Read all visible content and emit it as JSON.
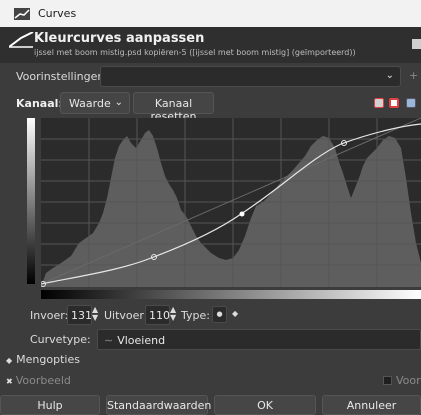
{
  "window": {
    "title": "Curves"
  },
  "header": {
    "title": "Kleurcurves aanpassen",
    "subtitle": "ijssel met boom mistig.psd kopiëren-5 ([ijssel met boom mistig] (geïmporteerd))"
  },
  "presets": {
    "label": "Voorinstellingen:",
    "value": "",
    "add": "+"
  },
  "channel": {
    "label": "Kanaal:",
    "value": "Waarde",
    "reset_label": "Kanaal resetten"
  },
  "curve": {
    "points": [
      [
        0,
        0
      ],
      [
        70,
        33
      ],
      [
        131,
        110
      ],
      [
        196,
        214
      ]
    ],
    "range": [
      0,
      255
    ]
  },
  "io": {
    "input_label": "Invoer:",
    "input_value": "131",
    "output_label": "Uitvoer:",
    "output_value": "110",
    "type_label": "Type:"
  },
  "curvetype": {
    "label": "Curvetype:",
    "value": "Vloeiend"
  },
  "options": {
    "mengopties": "Mengopties",
    "preview": "Voorbeeld",
    "preview2": "Voor"
  },
  "buttons": {
    "help": "Hulp",
    "defaults": "Standaardwaarden",
    "ok": "OK",
    "cancel": "Annuleer"
  },
  "colors": {
    "accent": "#e04040",
    "panel": "#3c3c3c",
    "plot_bg": "#3a3a3a"
  }
}
